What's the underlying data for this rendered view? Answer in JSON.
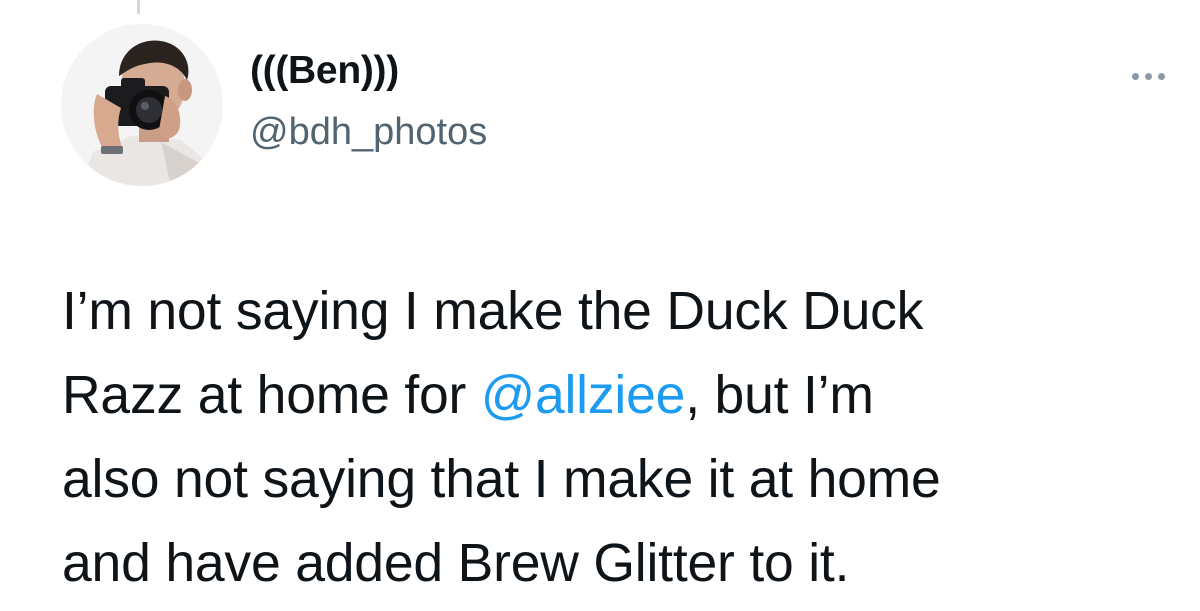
{
  "tweet": {
    "author": {
      "display_name": "(((Ben)))",
      "handle": "@bdh_photos"
    },
    "more_icon": "more-horizontal-icon",
    "text_lines": [
      {
        "before": "I’m not saying I make the Duck Duck",
        "mention": "",
        "after": ""
      },
      {
        "before": "Razz at home for ",
        "mention": "@allziee",
        "after": ", but I’m"
      },
      {
        "before": "also not saying that I make it at home",
        "mention": "",
        "after": ""
      },
      {
        "before": "and have added Brew Glitter to it.",
        "mention": "",
        "after": ""
      }
    ]
  },
  "colors": {
    "text": "#0f1419",
    "secondary": "#536471",
    "link": "#1d9bf0",
    "icon": "#8b98a5"
  }
}
